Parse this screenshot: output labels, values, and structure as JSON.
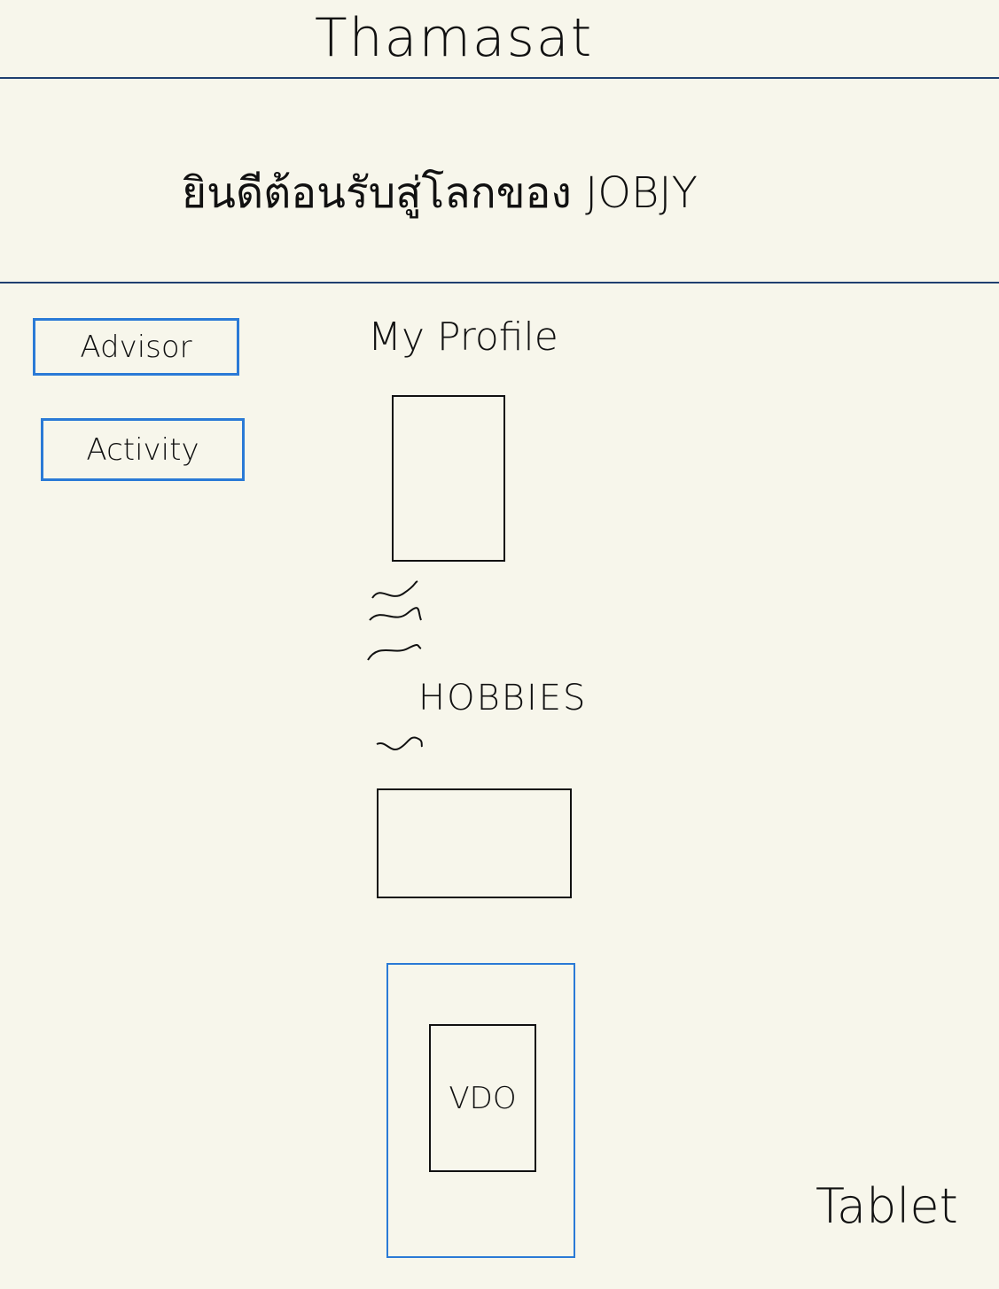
{
  "header": {
    "title": "Thamasat"
  },
  "banner": {
    "welcome_text": "ยินดีต้อนรับสู่โลกของ JOBJY"
  },
  "sidebar": {
    "items": [
      {
        "label": "Advisor"
      },
      {
        "label": "Activity"
      }
    ]
  },
  "main": {
    "profile_heading": "My Profile",
    "hobbies_heading": "HOBBIES",
    "video_label": "VDO"
  },
  "device_label": "Tablet",
  "colors": {
    "background": "#f7f6eb",
    "rule": "#1f3f70",
    "accent": "#2a7ad6",
    "ink": "#111111"
  }
}
